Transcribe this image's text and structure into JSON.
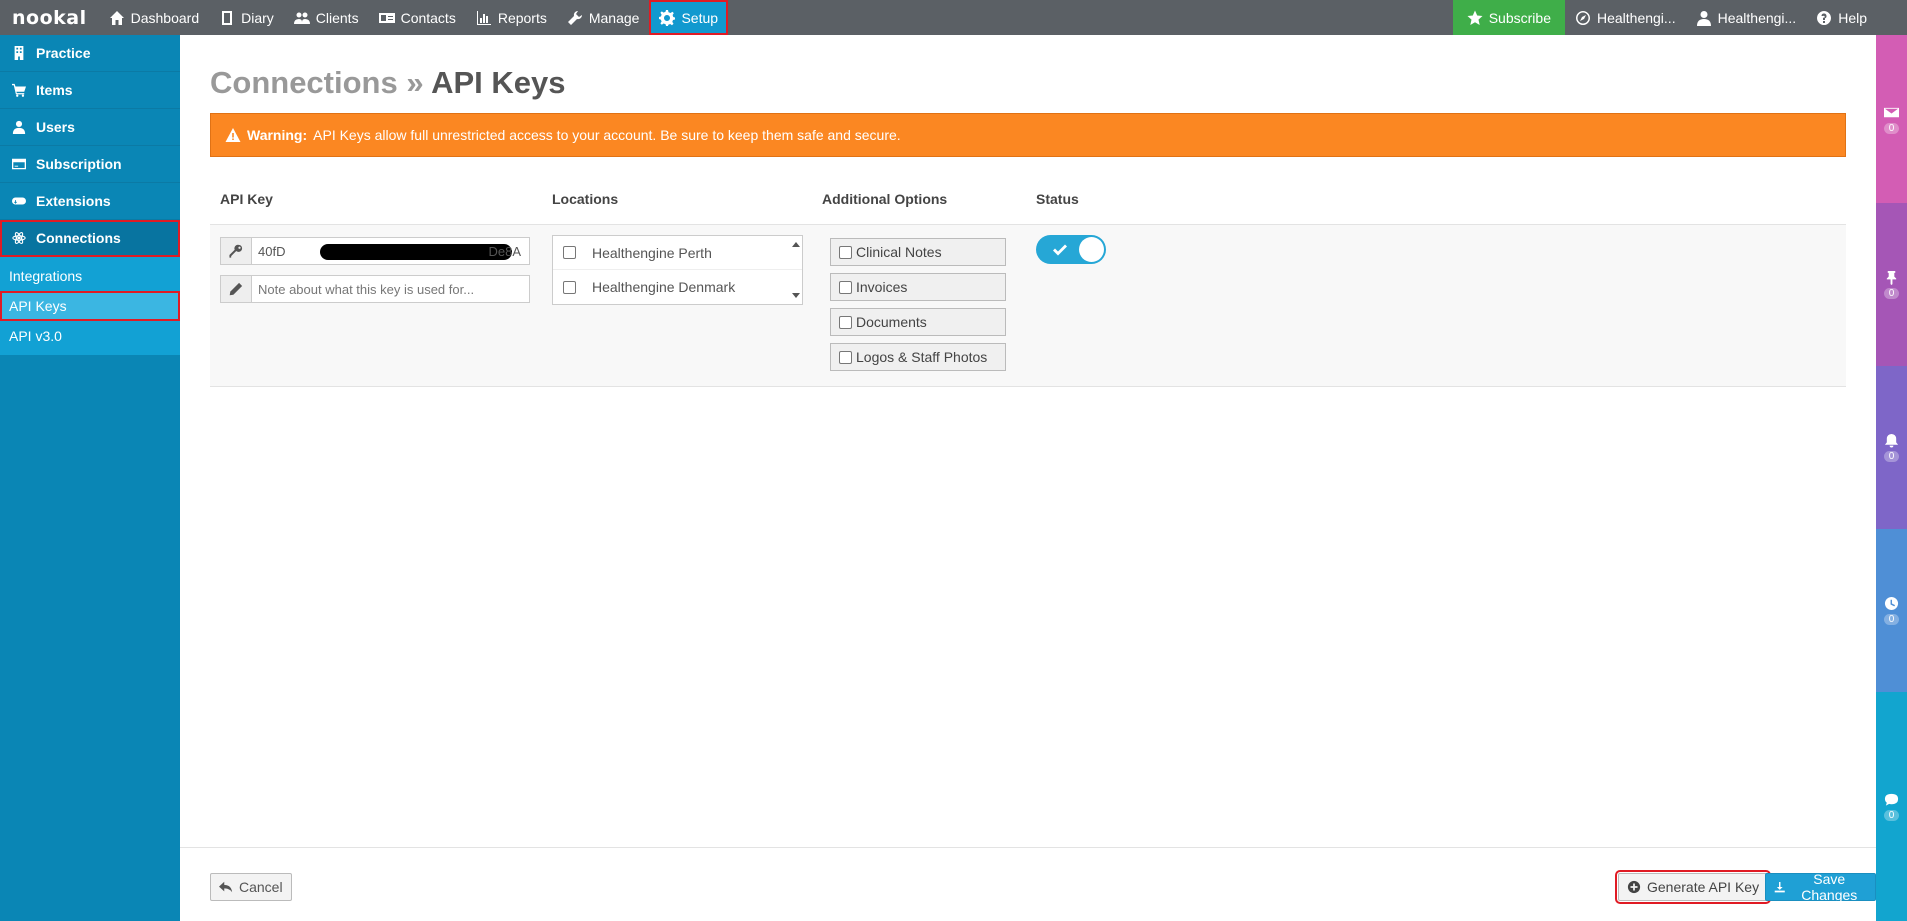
{
  "topnav": {
    "logo": "nookal",
    "items": [
      {
        "label": "Dashboard",
        "icon": "home-icon"
      },
      {
        "label": "Diary",
        "icon": "book-icon"
      },
      {
        "label": "Clients",
        "icon": "users-icon"
      },
      {
        "label": "Contacts",
        "icon": "address-card-icon"
      },
      {
        "label": "Reports",
        "icon": "bar-chart-icon"
      },
      {
        "label": "Manage",
        "icon": "wrench-icon"
      },
      {
        "label": "Setup",
        "icon": "gear-icon"
      }
    ],
    "subscribe": "Subscribe",
    "location": "Healthengi...",
    "user": "Healthengi...",
    "help": "Help"
  },
  "sidebar": {
    "items": [
      {
        "label": "Practice",
        "icon": "building-icon"
      },
      {
        "label": "Items",
        "icon": "cart-icon"
      },
      {
        "label": "Users",
        "icon": "user-icon"
      },
      {
        "label": "Subscription",
        "icon": "credit-card-icon"
      },
      {
        "label": "Extensions",
        "icon": "gamepad-icon"
      },
      {
        "label": "Connections",
        "icon": "atom-icon"
      }
    ],
    "subitems": [
      "Integrations",
      "API Keys",
      "API v3.0"
    ]
  },
  "page": {
    "crumb": "Connections »",
    "title": "API Keys",
    "warning_label": "Warning:",
    "warning_text": "API Keys allow full unrestricted access to your account. Be sure to keep them safe and secure."
  },
  "table": {
    "headers": {
      "api_key": "API Key",
      "locations": "Locations",
      "options": "Additional Options",
      "status": "Status"
    },
    "row": {
      "key_prefix": "40fD",
      "key_suffix": "De8A",
      "note_placeholder": "Note about what this key is used for...",
      "locations": [
        "Healthengine Perth",
        "Healthengine Denmark"
      ],
      "options": [
        "Clinical Notes",
        "Invoices",
        "Documents",
        "Logos & Staff Photos"
      ],
      "status_on": true
    }
  },
  "footer": {
    "cancel": "Cancel",
    "generate": "Generate API Key",
    "save": "Save Changes"
  },
  "rail": {
    "counts": [
      "0",
      "0",
      "0",
      "0",
      "0"
    ],
    "colors": [
      "#d35db4",
      "#a556b6",
      "#7e66c8",
      "#4f8fd6",
      "#12a5cf"
    ]
  },
  "colors": {
    "topbar": "#5b6065",
    "sidebar": "#0a86b5",
    "accent": "#1199cf",
    "warning": "#fb8722",
    "subscribe": "#3fae49",
    "highlight": "#e01b24"
  }
}
